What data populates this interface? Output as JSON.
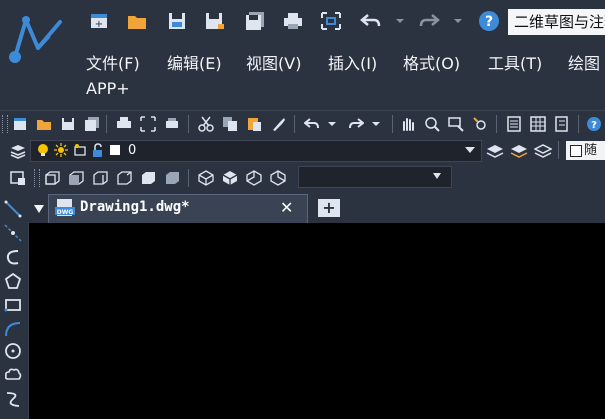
{
  "app": {
    "title": "二维草图与注释",
    "logo": "gstarcad-logo"
  },
  "colors": {
    "background": "#2b3240",
    "canvas": "#000000",
    "accent": "#3d8bd8",
    "folder": "#f0a53a",
    "help": "#3d8bd8"
  },
  "quick_access": [
    {
      "name": "new-file-icon"
    },
    {
      "name": "open-folder-icon"
    },
    {
      "name": "save-icon"
    },
    {
      "name": "save-as-icon"
    },
    {
      "name": "save-all-icon"
    },
    {
      "name": "print-icon"
    },
    {
      "name": "zoom-extents-icon"
    },
    {
      "name": "undo-icon"
    },
    {
      "name": "undo-dropdown-icon"
    },
    {
      "name": "redo-icon"
    },
    {
      "name": "redo-dropdown-icon"
    },
    {
      "name": "help-icon"
    }
  ],
  "menu": {
    "file": "文件(F)",
    "edit": "编辑(E)",
    "view": "视图(V)",
    "insert": "插入(I)",
    "format": "格式(O)",
    "tools": "工具(T)",
    "draw": "绘图",
    "app": "APP+"
  },
  "layer": {
    "current": "0"
  },
  "properties": {
    "linetype": "随"
  },
  "tabs": {
    "active_label": "Drawing1.dwg*",
    "close_symbol": "✕",
    "new_tab_symbol": "+"
  },
  "draw_tools": [
    {
      "name": "line-icon"
    },
    {
      "name": "construction-line-icon"
    },
    {
      "name": "polyline-icon"
    },
    {
      "name": "polygon-icon"
    },
    {
      "name": "rectangle-icon"
    },
    {
      "name": "arc-icon"
    },
    {
      "name": "circle-icon"
    },
    {
      "name": "revision-cloud-icon"
    },
    {
      "name": "spline-icon"
    }
  ]
}
